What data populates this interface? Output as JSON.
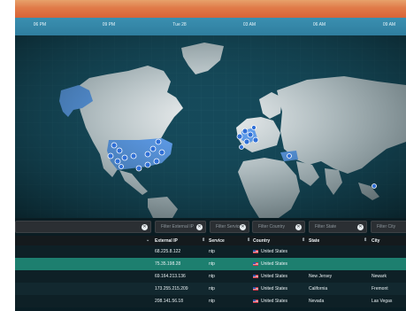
{
  "timeline": {
    "ticks": [
      "06 PM",
      "09 PM",
      "Tue 28",
      "03 AM",
      "06 AM",
      "09 AM"
    ]
  },
  "filters": [
    {
      "placeholder": ""
    },
    {
      "placeholder": "Filter External IP"
    },
    {
      "placeholder": "Filter Service"
    },
    {
      "placeholder": "Filter Country"
    },
    {
      "placeholder": "Filter State"
    },
    {
      "placeholder": "Filter City"
    }
  ],
  "table": {
    "columns": [
      "External IP",
      "Service",
      "Country",
      "State",
      "City"
    ],
    "rows": [
      {
        "ip": "68.225.8.122",
        "service": "ntp",
        "country": "United States",
        "state": "",
        "city": ""
      },
      {
        "ip": "75.35.198.28",
        "service": "ntp",
        "country": "United States",
        "state": "",
        "city": ""
      },
      {
        "ip": "69.164.213.136",
        "service": "ntp",
        "country": "United States",
        "state": "New Jersey",
        "city": "Newark"
      },
      {
        "ip": "173.255.215.209",
        "service": "ntp",
        "country": "United States",
        "state": "California",
        "city": "Fremont"
      },
      {
        "ip": "208.141.56.18",
        "service": "ntp",
        "country": "United States",
        "state": "Nevada",
        "city": "Las Vegas"
      }
    ]
  },
  "colors": {
    "timeline_orange": "#e07a48",
    "timeline_blue": "#2f7e9f",
    "highlight_region": "#6aa8ff",
    "selected_row": "#1d7f6f",
    "marker": "#2f6fd6"
  }
}
